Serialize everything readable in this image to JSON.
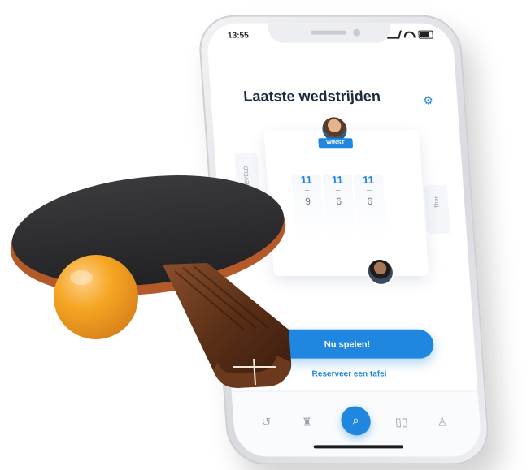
{
  "status": {
    "time": "13:55"
  },
  "header": {
    "title": "Laatste wedstrijden",
    "settings_icon": "gear-icon"
  },
  "match": {
    "winner_badge": "WINST",
    "left_side_label": "LEIDSEVELD",
    "right_side_label": "Thor",
    "sets": [
      {
        "win": "11",
        "lose": "9"
      },
      {
        "win": "11",
        "lose": "6"
      },
      {
        "win": "11",
        "lose": "6"
      }
    ]
  },
  "actions": {
    "play_now": "Nu spelen!",
    "reserve_table": "Reserveer een tafel"
  },
  "tabbar": {
    "items": [
      {
        "name": "history",
        "icon": "history-icon"
      },
      {
        "name": "trophy",
        "icon": "trophy-icon"
      },
      {
        "name": "play",
        "icon": "search-icon"
      },
      {
        "name": "map",
        "icon": "map-icon"
      },
      {
        "name": "profile",
        "icon": "profile-icon"
      }
    ]
  },
  "colors": {
    "accent": "#1f87e0",
    "title": "#1d2b3d",
    "ball": "#f5a623",
    "rubber": "#2e2e30"
  }
}
